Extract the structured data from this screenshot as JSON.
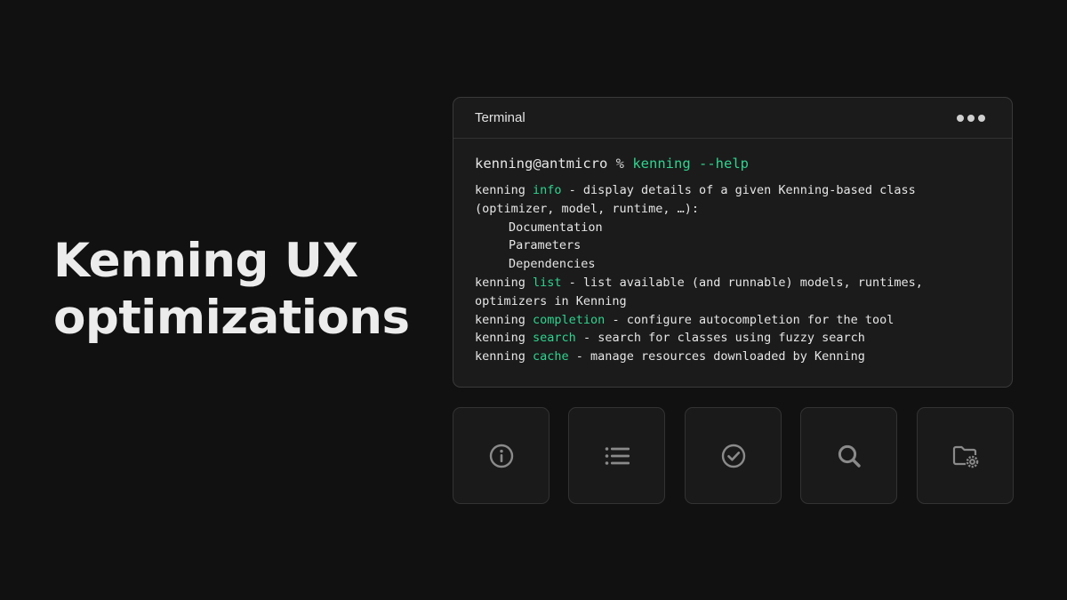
{
  "headline": {
    "line1": "Kenning UX",
    "line2": "optimizations"
  },
  "colors": {
    "background": "#111111",
    "panel": "#1b1b1b",
    "accent": "#2ed48f",
    "icon": "#8a8a8a"
  },
  "terminal": {
    "title": "Terminal",
    "menu_icon": "ellipsis-icon",
    "prompt": {
      "user": "kenning@antmicro",
      "symbol": "%",
      "command": "kenning --help"
    },
    "lines": [
      {
        "prefix": "kenning ",
        "keyword": "info",
        "text": " - display details of a given Kenning-based class"
      },
      {
        "text": "(optimizer, model, runtime, …):"
      },
      {
        "text": "Documentation"
      },
      {
        "text": "Parameters"
      },
      {
        "text": "Dependencies"
      },
      {
        "prefix": "kenning ",
        "keyword": "list",
        "text": " - list available (and runnable) models, runtimes,"
      },
      {
        "text": "optimizers in Kenning"
      },
      {
        "prefix": "kenning ",
        "keyword": "completion",
        "text": " - configure autocompletion for the tool"
      },
      {
        "prefix": "kenning ",
        "keyword": "search",
        "text": " - search for classes using fuzzy search"
      },
      {
        "prefix": "kenning ",
        "keyword": "cache",
        "text": " - manage resources downloaded by Kenning"
      }
    ]
  },
  "tiles": [
    {
      "icon": "info-icon"
    },
    {
      "icon": "list-icon"
    },
    {
      "icon": "check-circle-icon"
    },
    {
      "icon": "search-icon"
    },
    {
      "icon": "folder-settings-icon"
    }
  ]
}
